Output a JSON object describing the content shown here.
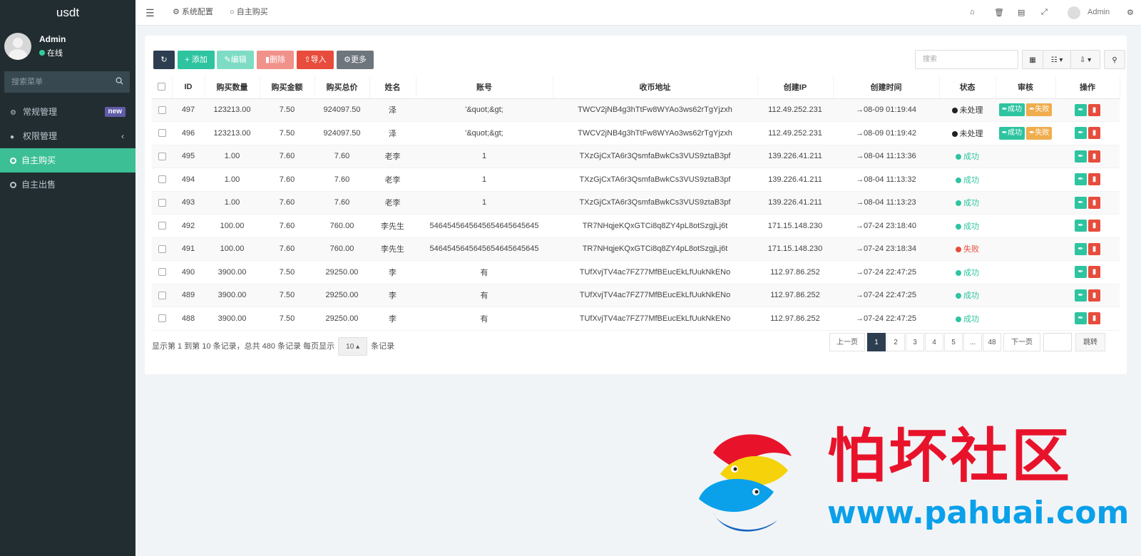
{
  "app": {
    "brand": "usdt"
  },
  "user": {
    "name": "Admin",
    "status": "在线"
  },
  "sidebar": {
    "search_placeholder": "搜索菜单",
    "items": [
      {
        "label": "常规管理",
        "badge": "new"
      },
      {
        "label": "权限管理",
        "chevron": "‹"
      },
      {
        "label": "自主购买",
        "active": true
      },
      {
        "label": "自主出售"
      }
    ]
  },
  "topbar": {
    "tabs": [
      {
        "label": "系统配置",
        "icon": "gear-icon"
      },
      {
        "label": "自主购买",
        "icon": "circle-icon"
      }
    ],
    "admin_label": "Admin"
  },
  "toolbar": {
    "add": "添加",
    "edit": "编辑",
    "delete": "删除",
    "import": "导入",
    "more": "更多",
    "search_placeholder": "搜索"
  },
  "table": {
    "headers": [
      "ID",
      "购买数量",
      "购买金额",
      "购买总价",
      "姓名",
      "账号",
      "收币地址",
      "创建IP",
      "创建时间",
      "状态",
      "审核",
      "操作"
    ],
    "rows": [
      {
        "id": "497",
        "qty": "123213.00",
        "amount": "7.50",
        "total": "924097.50",
        "name": "泽",
        "account": "'&quot;&gt;",
        "address": "TWCV2jNB4g3hTtFw8WYAo3ws62rTgYjzxh",
        "ip": "112.49.252.231",
        "time": "→08-09 01:19:44",
        "status": "未处理",
        "status_type": "pending",
        "review": true
      },
      {
        "id": "496",
        "qty": "123213.00",
        "amount": "7.50",
        "total": "924097.50",
        "name": "泽",
        "account": "'&quot;&gt;",
        "address": "TWCV2jNB4g3hTtFw8WYAo3ws62rTgYjzxh",
        "ip": "112.49.252.231",
        "time": "→08-09 01:19:42",
        "status": "未处理",
        "status_type": "pending",
        "review": true
      },
      {
        "id": "495",
        "qty": "1.00",
        "amount": "7.60",
        "total": "7.60",
        "name": "老李",
        "account": "1",
        "address": "TXzGjCxTA6r3QsmfaBwkCs3VUS9ztaB3pf",
        "ip": "139.226.41.211",
        "time": "→08-04 11:13:36",
        "status": "成功",
        "status_type": "ok",
        "review": false
      },
      {
        "id": "494",
        "qty": "1.00",
        "amount": "7.60",
        "total": "7.60",
        "name": "老李",
        "account": "1",
        "address": "TXzGjCxTA6r3QsmfaBwkCs3VUS9ztaB3pf",
        "ip": "139.226.41.211",
        "time": "→08-04 11:13:32",
        "status": "成功",
        "status_type": "ok",
        "review": false
      },
      {
        "id": "493",
        "qty": "1.00",
        "amount": "7.60",
        "total": "7.60",
        "name": "老李",
        "account": "1",
        "address": "TXzGjCxTA6r3QsmfaBwkCs3VUS9ztaB3pf",
        "ip": "139.226.41.211",
        "time": "→08-04 11:13:23",
        "status": "成功",
        "status_type": "ok",
        "review": false
      },
      {
        "id": "492",
        "qty": "100.00",
        "amount": "7.60",
        "total": "760.00",
        "name": "李先生",
        "account": "5464545645645654645645645",
        "address": "TR7NHqjeKQxGTCi8q8ZY4pL8otSzgjLj6t",
        "ip": "171.15.148.230",
        "time": "→07-24 23:18:40",
        "status": "成功",
        "status_type": "ok",
        "review": false
      },
      {
        "id": "491",
        "qty": "100.00",
        "amount": "7.60",
        "total": "760.00",
        "name": "李先生",
        "account": "5464545645645654645645645",
        "address": "TR7NHqjeKQxGTCi8q8ZY4pL8otSzgjLj6t",
        "ip": "171.15.148.230",
        "time": "→07-24 23:18:34",
        "status": "失败",
        "status_type": "fail",
        "review": false
      },
      {
        "id": "490",
        "qty": "3900.00",
        "amount": "7.50",
        "total": "29250.00",
        "name": "李",
        "account": "有",
        "address": "TUfXvjTV4ac7FZ77MfBEucEkLfUukNkENo",
        "ip": "112.97.86.252",
        "time": "→07-24 22:47:25",
        "status": "成功",
        "status_type": "ok",
        "review": false
      },
      {
        "id": "489",
        "qty": "3900.00",
        "amount": "7.50",
        "total": "29250.00",
        "name": "李",
        "account": "有",
        "address": "TUfXvjTV4ac7FZ77MfBEucEkLfUukNkENo",
        "ip": "112.97.86.252",
        "time": "→07-24 22:47:25",
        "status": "成功",
        "status_type": "ok",
        "review": false
      },
      {
        "id": "488",
        "qty": "3900.00",
        "amount": "7.50",
        "total": "29250.00",
        "name": "李",
        "account": "有",
        "address": "TUfXvjTV4ac7FZ77MfBEucEkLfUukNkENo",
        "ip": "112.97.86.252",
        "time": "→07-24 22:47:25",
        "status": "成功",
        "status_type": "ok",
        "review": false
      }
    ],
    "review_ok": "成功",
    "review_fail": "失败"
  },
  "pagination": {
    "info_prefix": "显示第 1 到第 10 条记录，总共 480 条记录 每页显示",
    "page_size": "10",
    "info_suffix": "条记录",
    "prev": "上一页",
    "pages": [
      "1",
      "2",
      "3",
      "4",
      "5",
      "...",
      "48"
    ],
    "current": "1",
    "next": "下一页",
    "jump": "跳转"
  },
  "watermark": {
    "text": "怕坏社区",
    "url": "www.pahuai.com"
  },
  "colors": {
    "sidebar": "#222d32",
    "accent": "#3cbf94",
    "danger": "#e74c3c",
    "warning": "#f0ad4e",
    "dark": "#2c3e50"
  }
}
